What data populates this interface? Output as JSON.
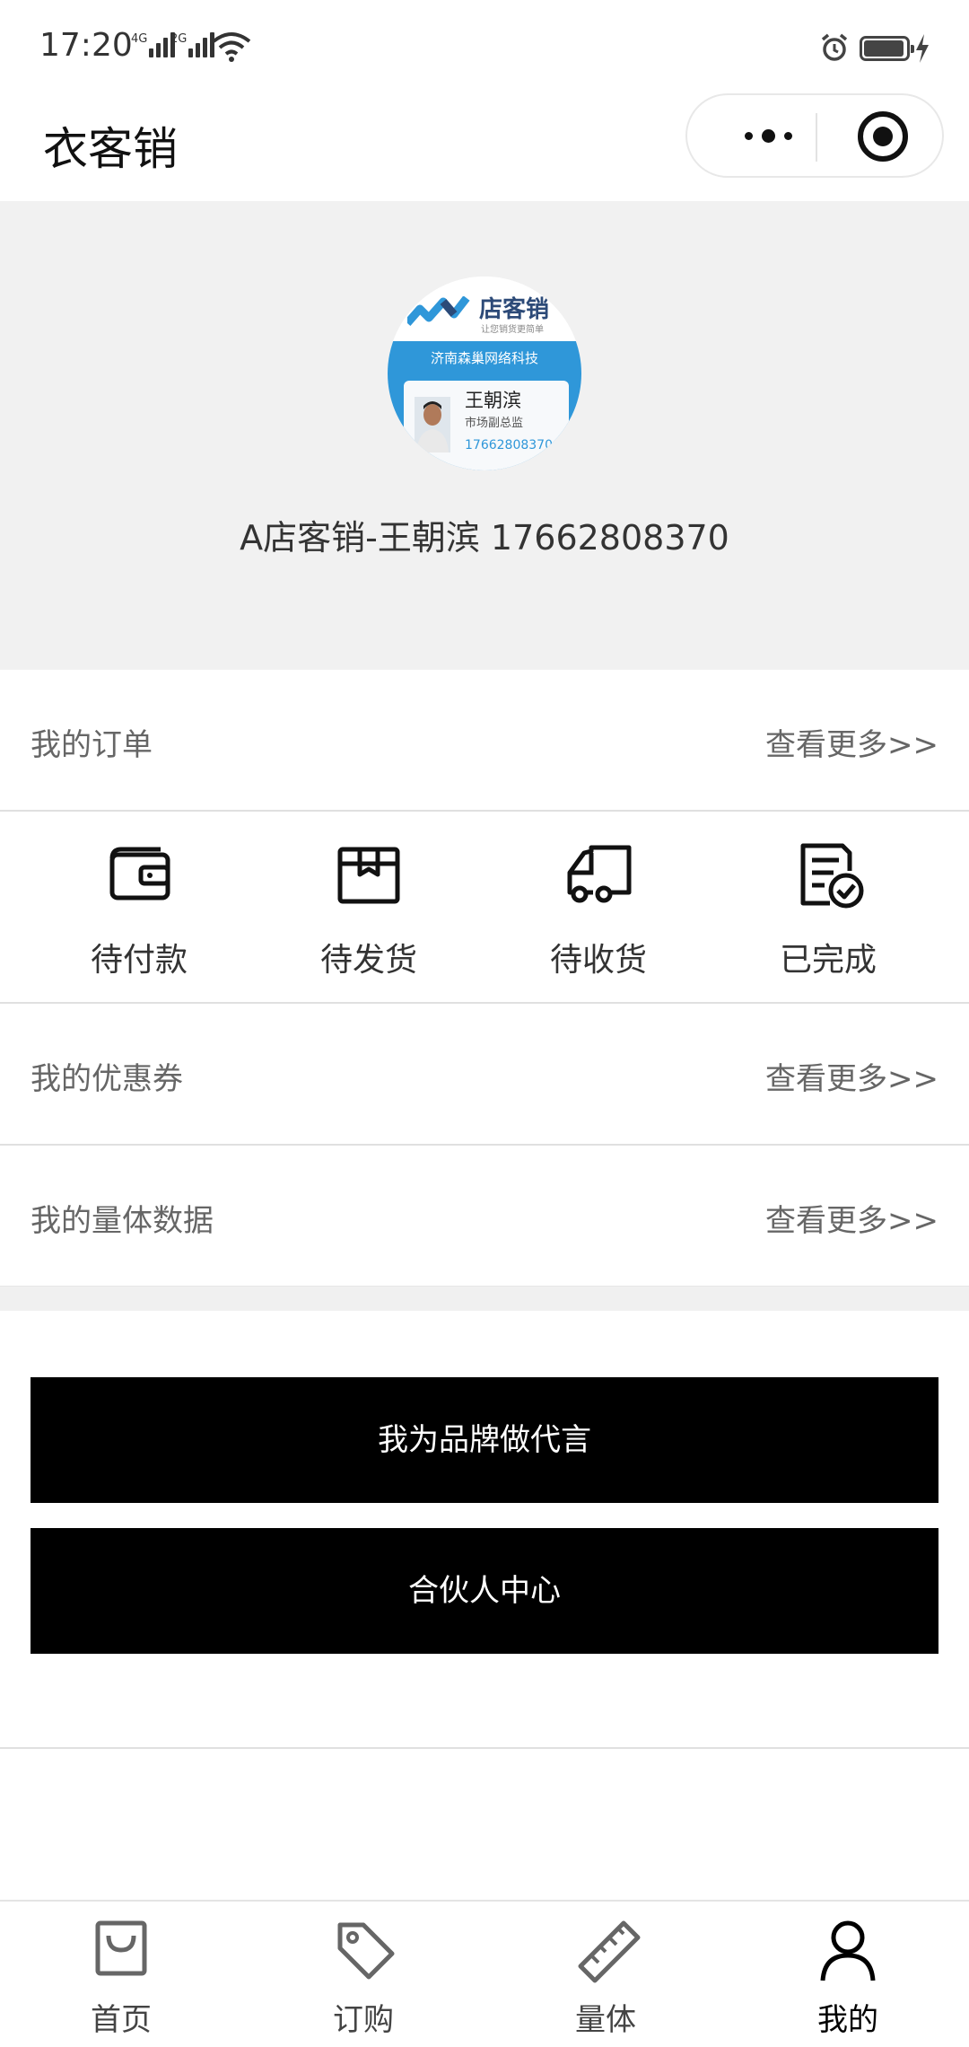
{
  "status_bar": {
    "time": "17:20",
    "net1": "4G",
    "net2": "2G"
  },
  "nav": {
    "title": "衣客销"
  },
  "profile": {
    "avatar": {
      "brand": "店客销",
      "slogan": "让您销货更简单",
      "company": "济南森巢网络科技",
      "person_name": "王朝滨",
      "role": "市场副总监",
      "phone": "17662808370"
    },
    "display_name": "A店客销-王朝滨 17662808370"
  },
  "orders": {
    "label": "我的订单",
    "more": "查看更多>>",
    "items": [
      {
        "label": "待付款",
        "icon": "wallet-icon"
      },
      {
        "label": "待发货",
        "icon": "package-icon"
      },
      {
        "label": "待收货",
        "icon": "truck-icon"
      },
      {
        "label": "已完成",
        "icon": "completed-document-icon"
      }
    ]
  },
  "coupons": {
    "label": "我的优惠券",
    "more": "查看更多>>"
  },
  "measurements": {
    "label": "我的量体数据",
    "more": "查看更多>>"
  },
  "buttons": {
    "ambassador": "我为品牌做代言",
    "partner": "合伙人中心"
  },
  "tabbar": {
    "active": "我的",
    "tabs": [
      {
        "label": "首页",
        "icon": "shopping-bag-icon"
      },
      {
        "label": "订购",
        "icon": "tag-icon"
      },
      {
        "label": "量体",
        "icon": "ruler-icon"
      },
      {
        "label": "我的",
        "icon": "person-icon"
      }
    ]
  },
  "colors": {
    "accent_blue": "#2f97d9",
    "button_bg": "#000000",
    "section_bg": "#f1f1f1"
  }
}
